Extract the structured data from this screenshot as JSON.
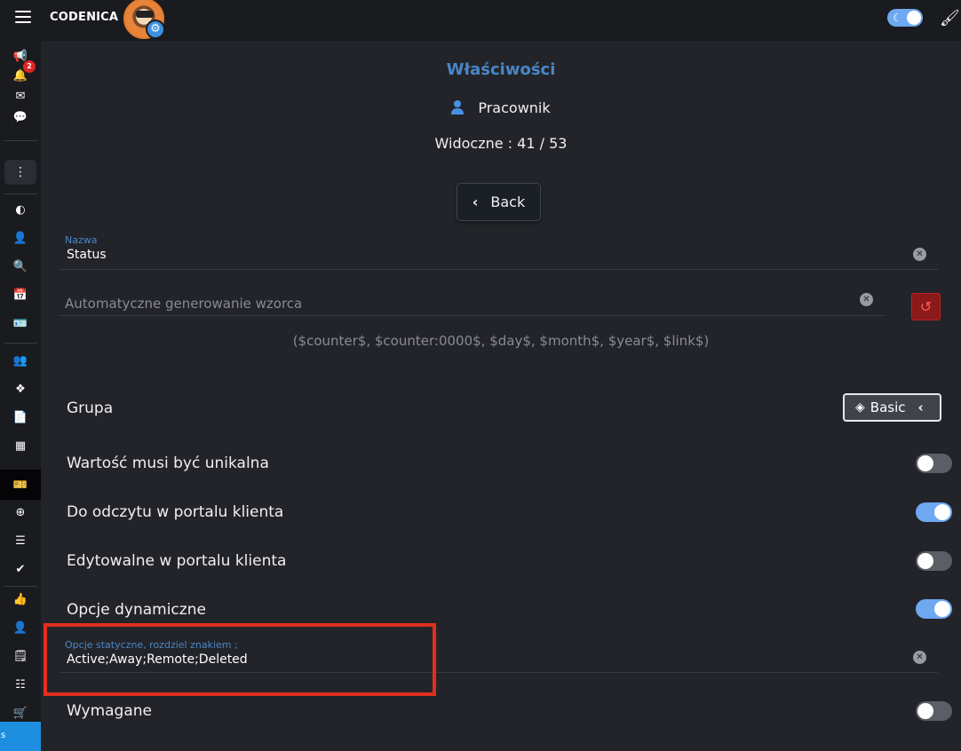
{
  "topbar": {
    "brand": "CODENICA",
    "icons": [
      "hamburger-icon",
      "avatar",
      "settings-gear-icon",
      "theme-toggle",
      "brush-icon"
    ]
  },
  "sidebar": {
    "notification_count": "2",
    "bottom_label": "s",
    "icons": [
      "megaphone-icon",
      "bell-icon",
      "envelope-icon",
      "chat-icon",
      "more-vertical-icon",
      "dashboard-icon",
      "user-icon",
      "search-icon",
      "calendar-icon",
      "id-card-icon",
      "users-icon",
      "cubes-icon",
      "file-icon",
      "building-icon",
      "ticket-icon",
      "plus-circle-icon",
      "list-icon",
      "check-double-icon",
      "thumbs-up-icon",
      "user-check-icon",
      "note-icon",
      "checklist-icon",
      "cart-icon"
    ]
  },
  "main": {
    "title": "Właściwości",
    "entity_name": "Pracownik",
    "visible_count": "Widoczne : 41 / 53",
    "back_label": "Back",
    "name_field": {
      "label": "Nazwa",
      "value": "Status"
    },
    "pattern_field": {
      "placeholder": "Automatyczne generowanie wzorca"
    },
    "pattern_hint": "($counter$, $counter:0000$, $day$, $month$, $year$, $link$)",
    "group": {
      "label": "Grupa",
      "value": "Basic"
    },
    "toggles": [
      {
        "label": "Wartość musi być unikalna",
        "on": false
      },
      {
        "label": "Do odczytu w portalu klienta",
        "on": true
      },
      {
        "label": "Edytowalne w portalu klienta",
        "on": false
      },
      {
        "label": "Opcje dynamiczne",
        "on": true
      }
    ],
    "static_options": {
      "label": "Opcje statyczne, rozdziel znakiem ;",
      "value": "Active;Away;Remote;Deleted"
    },
    "required": {
      "label": "Wymagane",
      "on": false
    }
  },
  "colors": {
    "accent": "#4a86c8",
    "toggle_on": "#6ea8f0",
    "highlight": "#e0301e",
    "reset": "#8b1a1a"
  }
}
